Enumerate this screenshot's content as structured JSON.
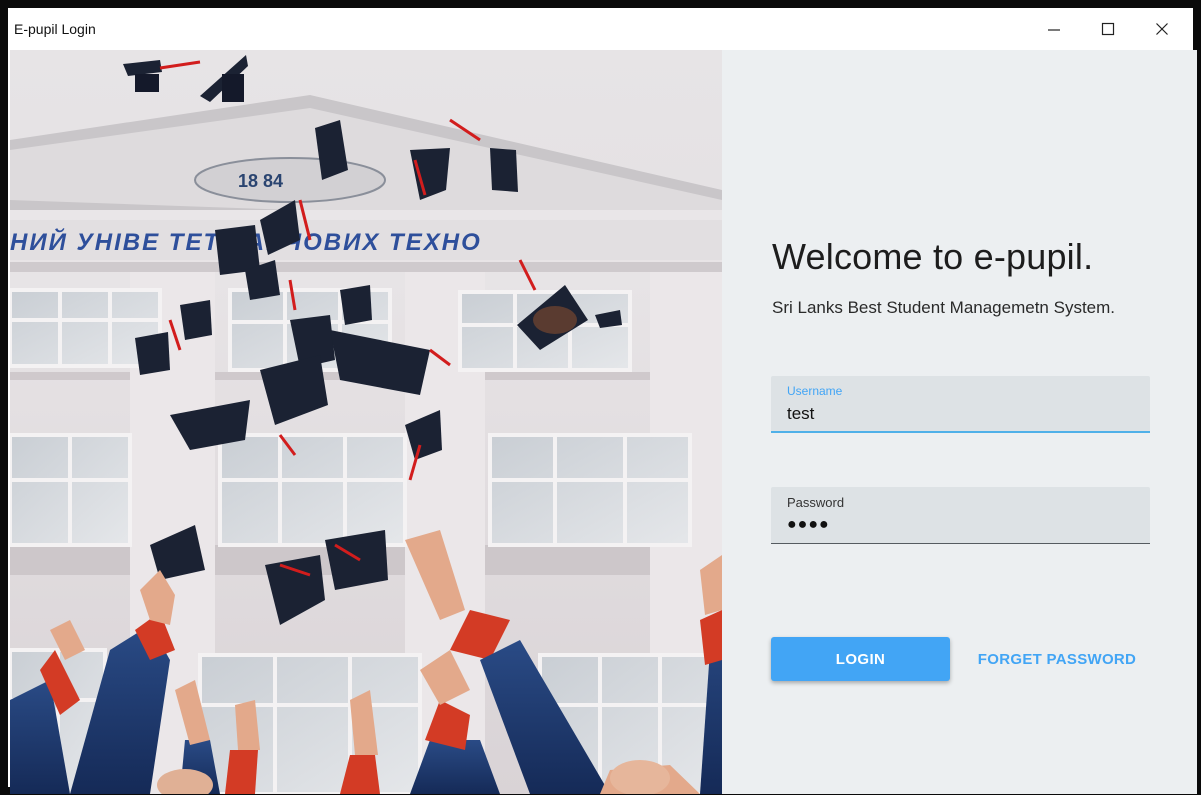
{
  "window": {
    "title": "E-pupil Login",
    "controls": {
      "minimize_icon": "minimize-icon",
      "maximize_icon": "maximize-icon",
      "close_icon": "close-icon"
    }
  },
  "hero_image": {
    "sign_text": "НИЙ УНІВЕ   ТЕТ ХАРЧОВИХ ТЕХНО",
    "emblem_text": "18  84"
  },
  "login": {
    "heading": "Welcome to e-pupil.",
    "tagline": "Sri Lanks Best Student Managemetn System.",
    "username": {
      "label": "Username",
      "value": "test"
    },
    "password": {
      "label": "Password",
      "value": "●●●●"
    },
    "login_button": "LOGIN",
    "forget_button": "FORGET PASSWORD"
  },
  "colors": {
    "accent": "#42a5f5",
    "panel_bg": "#eceff1",
    "field_bg": "#dde2e5"
  }
}
